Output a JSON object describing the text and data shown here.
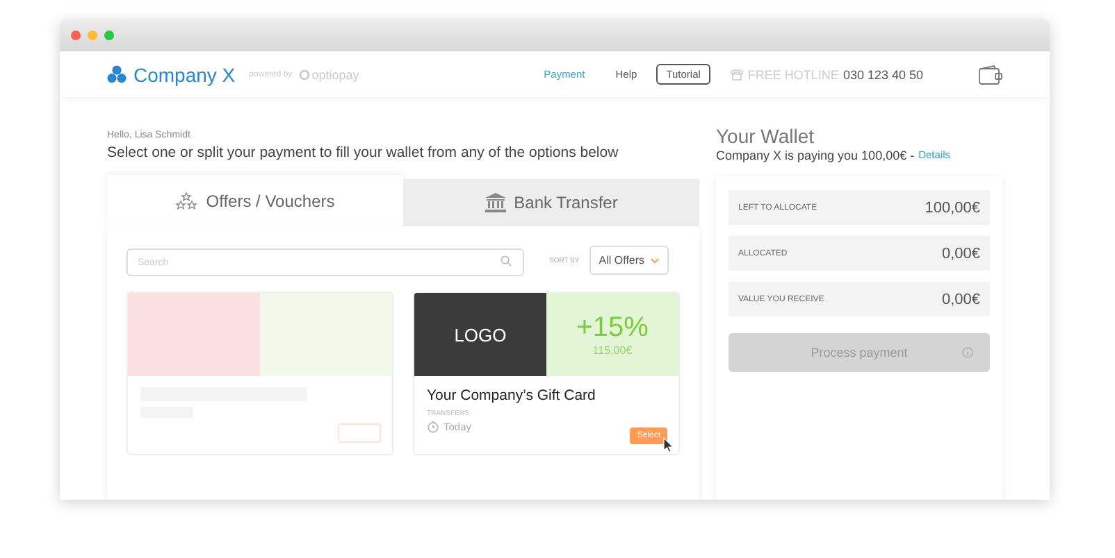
{
  "header": {
    "brand": "Company X",
    "powered_by": "powered by",
    "partner": "optiopay",
    "nav": [
      {
        "label": "Payment",
        "selected": true,
        "kind": "link"
      },
      {
        "label": "Help",
        "selected": false,
        "kind": "link"
      },
      {
        "label": "Tutorial",
        "selected": false,
        "kind": "boxed"
      }
    ],
    "hotline_label": "FREE HOTLINE",
    "hotline_number": "030 123 40 50"
  },
  "greeting": "Hello, Lisa Schmidt",
  "instruction": "Select one or split your payment to fill your wallet from any of the options below",
  "tabs": [
    {
      "label": "Offers / Vouchers",
      "selected": true,
      "kind": "stars"
    },
    {
      "label": "Bank Transfer",
      "selected": false,
      "kind": "bank"
    }
  ],
  "search": {
    "placeholder": "Search"
  },
  "sort": {
    "label": "SORT BY",
    "value": "All Offers"
  },
  "offers": [
    {
      "kind": "placeholder"
    },
    {
      "kind": "offer",
      "logo": "LOGO",
      "bonus": "+15%",
      "value": "115,00€",
      "title": "Your Company’s Gift Card",
      "category": "TRANSFERS",
      "time": "Today",
      "action": "Select"
    }
  ],
  "wallet": {
    "title": "Your Wallet",
    "subtitle": "Company X is paying you 100,00€ -",
    "details": "Details",
    "rows": [
      {
        "label": "LEFT TO ALLOCATE",
        "value": "100,00€"
      },
      {
        "label": "ALLOCATED",
        "value": "0,00€"
      },
      {
        "label": "VALUE YOU RECEIVE",
        "value": "0,00€"
      }
    ],
    "button": {
      "label": "Process payment",
      "disabled": true
    }
  }
}
